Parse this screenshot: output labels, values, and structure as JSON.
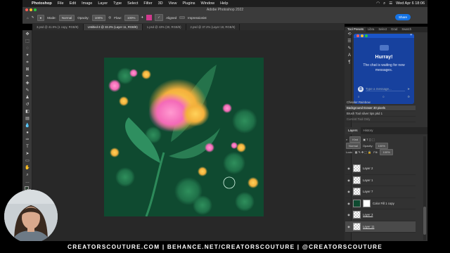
{
  "menubar": {
    "apple": "",
    "app_name": "Photoshop",
    "items": [
      "File",
      "Edit",
      "Image",
      "Layer",
      "Type",
      "Select",
      "Filter",
      "3D",
      "View",
      "Plugins",
      "Window",
      "Help"
    ],
    "datetime": "Wed Apr 6  18:06"
  },
  "window": {
    "title": "Adobe Photoshop 2022"
  },
  "options": {
    "mode_label": "Mode:",
    "mode_value": "Normal",
    "opacity_label": "Opacity:",
    "opacity_value": "100%",
    "flow_label": "Flow:",
    "flow_value": "100%",
    "aligned_label": "Aligned",
    "impressionist_label": "Impressionist",
    "share_label": "Share"
  },
  "tabs": [
    {
      "label": "3.psd @ 41.9% (1 copy, RGB/8)"
    },
    {
      "label": "Untitled-3 @ 33.3% (Layer 11, RGB/8)"
    },
    {
      "label": "1.psd @ 43% (30, RGB/8)"
    },
    {
      "label": "2.psd @ 37.2% (Layer 18, RGB/8)"
    }
  ],
  "panel_tabs": [
    "Tool Presets",
    "Libra",
    "Select",
    "Grad",
    "Swatch"
  ],
  "chat": {
    "title": "Hurray!",
    "message": "The chat is waiting for new messages.",
    "avatar": "B",
    "input_placeholder": "Type a message...",
    "foot_left": "0",
    "foot_mid": "0"
  },
  "history": {
    "items": [
      {
        "label": "Chisoler Rainbow"
      },
      {
        "label": "Background Eraser 30 pixels"
      },
      {
        "label": "Brush Tool silver tips pkd 1"
      },
      {
        "label": "Current Tool Only"
      }
    ]
  },
  "layers_panel": {
    "tabs": [
      "Layers",
      "History"
    ],
    "kind_label": "Kind",
    "blend_mode": "Normal",
    "opacity_label": "Opacity:",
    "opacity_value": "100%",
    "lock_label": "Lock:",
    "fill_label": "Fill:",
    "fill_value": "100%",
    "layers": [
      {
        "name": "Layer 2",
        "type": "pixel",
        "selected": false
      },
      {
        "name": "Layer 1",
        "type": "pixel",
        "selected": false
      },
      {
        "name": "Layer 7",
        "type": "pixel",
        "selected": false
      },
      {
        "name": "Color Fill 1 copy",
        "type": "fill",
        "selected": false
      },
      {
        "name": "Layer 3",
        "type": "pixel",
        "selected": false
      },
      {
        "name": "Layer 11",
        "type": "pixel",
        "selected": true
      }
    ]
  },
  "footer": {
    "text": "CREATORSCOUTURE.COM  |  BEHANCE.NET/CREATORSCOUTURE  |  @CREATORSCOUTURE"
  },
  "colors": {
    "canvas_bg": "#0f4a30",
    "chat_bg": "#17419e",
    "share_blue": "#1473e6"
  }
}
